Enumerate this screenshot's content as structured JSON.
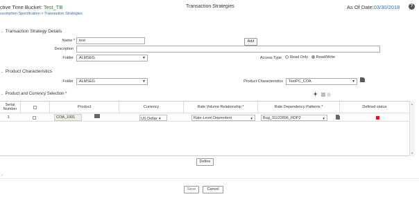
{
  "header": {
    "bucket_label": "ctive Time Bucket: ",
    "bucket_value": "Test_TB",
    "breadcrumb": "ssumption Specification > Transaction Strategies",
    "page_title": "Transaction Strategies",
    "as_of_label": "As Of Date:",
    "as_of_value": "03/30/2018",
    "help_icon": "question-circle-icon"
  },
  "details": {
    "section_title": "Transaction Strategy Details",
    "name_label": "Name",
    "name_value": "test",
    "add_label": "Add",
    "description_label": "Description",
    "description_value": "",
    "folder_label": "Folder",
    "folder_value": "ALMSEG",
    "access_label": "Access Type",
    "access_options": [
      "Read Only",
      "Read/Write"
    ],
    "access_selected": "Read/Write"
  },
  "product_chars": {
    "section_title": "Product Characteristics",
    "folder_label": "Folder",
    "folder_value": "ALMSEG",
    "pc_label": "Product Characteristics",
    "pc_value": "TestPC_COA"
  },
  "selection": {
    "section_title": "Product and Currency Selection",
    "columns": [
      "Serial Number",
      "",
      "Product",
      "Currency",
      "Rate Volume Relationship",
      "Rate Dependency Patterns",
      "Defined status"
    ],
    "rows": [
      {
        "serial": "1",
        "product": "COA_1001",
        "currency": "US Dollar",
        "rate_volume": "Rate-Level Dependent",
        "rate_dependency": "Bug_31122896_RDP2"
      }
    ],
    "status_color": "#e8101a"
  },
  "actions": {
    "define_label": "Define",
    "save_label": "Save",
    "cancel_label": "Cancel"
  }
}
